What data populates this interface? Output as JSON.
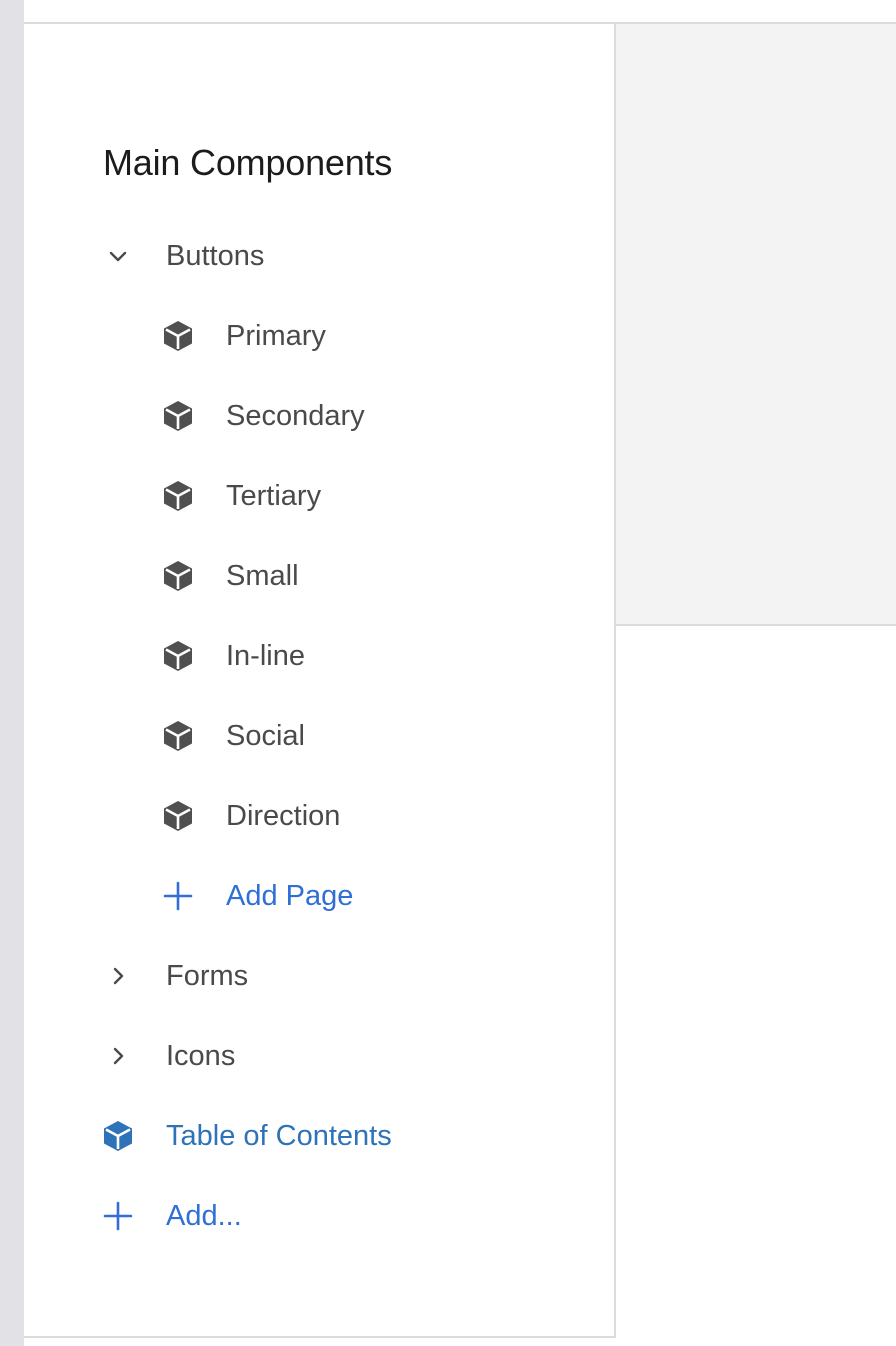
{
  "sidebar": {
    "title": "Main Components",
    "groups": [
      {
        "label": "Buttons",
        "expanded": true,
        "toggle_icon": "chevron-down-icon",
        "pages": [
          {
            "label": "Primary",
            "icon": "cube-icon"
          },
          {
            "label": "Secondary",
            "icon": "cube-icon"
          },
          {
            "label": "Tertiary",
            "icon": "cube-icon"
          },
          {
            "label": "Small",
            "icon": "cube-icon"
          },
          {
            "label": "In-line",
            "icon": "cube-icon"
          },
          {
            "label": "Social",
            "icon": "cube-icon"
          },
          {
            "label": "Direction",
            "icon": "cube-icon"
          }
        ],
        "add_page_label": "Add Page"
      },
      {
        "label": "Forms",
        "expanded": false,
        "toggle_icon": "chevron-right-icon"
      },
      {
        "label": "Icons",
        "expanded": false,
        "toggle_icon": "chevron-right-icon"
      }
    ],
    "table_of_contents": {
      "label": "Table of Contents",
      "icon": "cube-icon"
    },
    "add_label": "Add..."
  },
  "colors": {
    "text": "#4a4a4a",
    "title": "#1c1c1c",
    "link_blue": "#2f6fd6",
    "toc_blue": "#2e72b8",
    "icon_gray": "#505050",
    "preview_bg": "#f3f3f3",
    "rail": "#e1e1e6"
  }
}
